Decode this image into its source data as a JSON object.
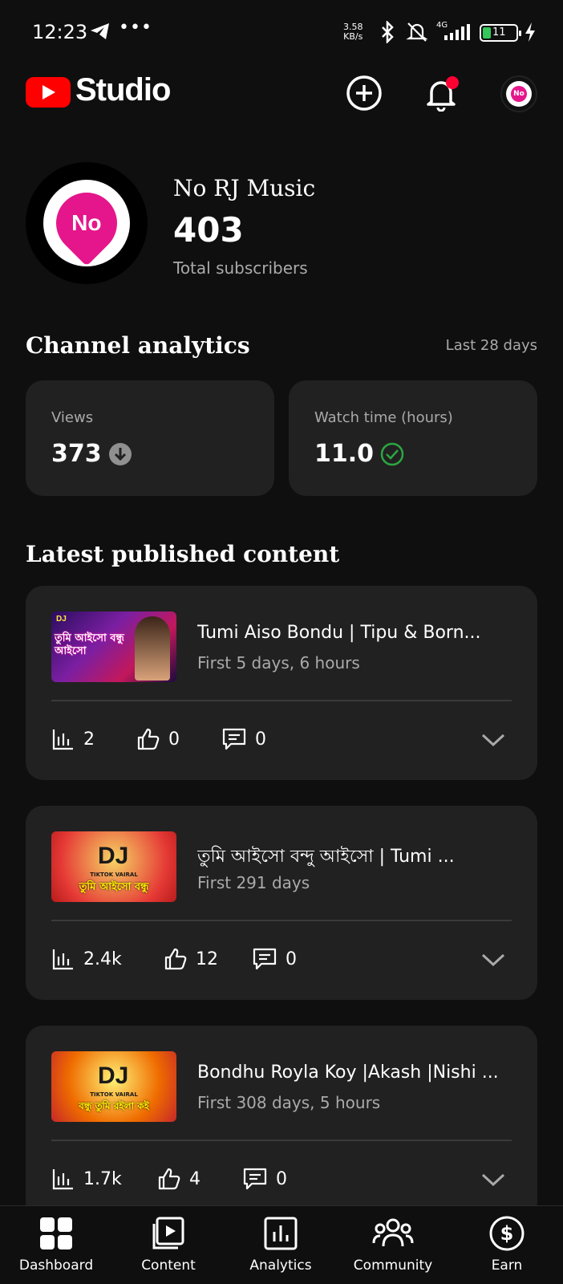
{
  "status_bar": {
    "time": "12:23",
    "dots": "•••",
    "speed": "3.58",
    "speed_unit": "KB/s",
    "network": "4G",
    "battery": "11"
  },
  "header": {
    "logo_text": "Studio"
  },
  "channel": {
    "avatar_text": "No",
    "name": "No RJ Music",
    "subscribers": "403",
    "subscribers_label": "Total subscribers"
  },
  "analytics": {
    "title": "Channel analytics",
    "period": "Last 28 days",
    "cards": [
      {
        "label": "Views",
        "value": "373"
      },
      {
        "label": "Watch time (hours)",
        "value": "11.0"
      }
    ]
  },
  "latest": {
    "title": "Latest published content",
    "items": [
      {
        "title": "Tumi Aiso Bondu | Tipu & Born...",
        "subtitle": "First 5 days, 6 hours",
        "thumb_dj": "DJ",
        "thumb_bn": "তুমি আইসো বন্ধু আইসো",
        "views": "2",
        "likes": "0",
        "comments": "0"
      },
      {
        "title": "তুমি আইসো বন্দু আইসো | Tumi ...",
        "subtitle": "First 291 days",
        "thumb_dj": "DJ",
        "thumb_tag": "TIKTOK VAIRAL",
        "thumb_bn": "তুমি আইসো বন্ধু",
        "views": "2.4k",
        "likes": "12",
        "comments": "0"
      },
      {
        "title": "Bondhu Royla Koy |Akash |Nishi ...",
        "subtitle": "First 308 days, 5 hours",
        "thumb_dj": "DJ",
        "thumb_tag": "TIKTOK VAIRAL",
        "thumb_bn": "বন্ধু তুমি রইলা কই",
        "views": "1.7k",
        "likes": "4",
        "comments": "0"
      }
    ]
  },
  "nav": [
    {
      "label": "Dashboard",
      "icon": "dashboard-icon"
    },
    {
      "label": "Content",
      "icon": "content-icon"
    },
    {
      "label": "Analytics",
      "icon": "analytics-icon"
    },
    {
      "label": "Community",
      "icon": "community-icon"
    },
    {
      "label": "Earn",
      "icon": "earn-icon"
    }
  ],
  "colors": {
    "background": "#0f0f0f",
    "card": "#212121",
    "brand_red": "#ff0000",
    "avatar_pink": "#e5168b",
    "success_green": "#2ba640"
  }
}
